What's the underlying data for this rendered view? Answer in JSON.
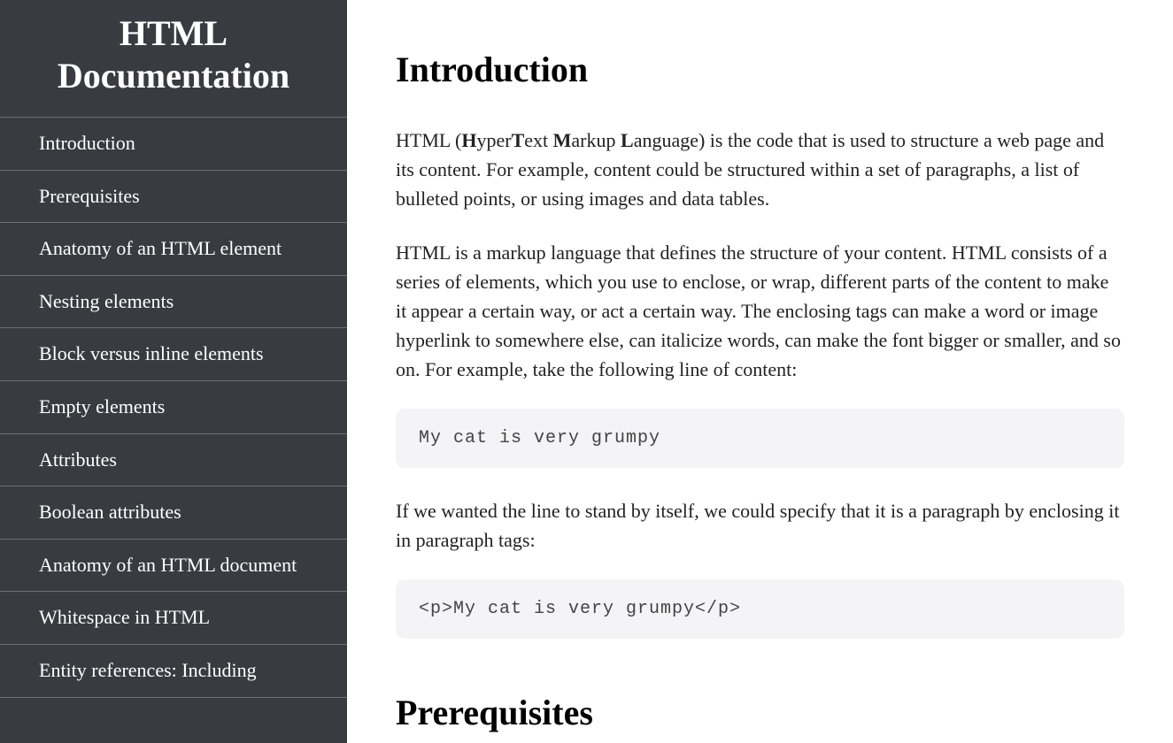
{
  "sidebar": {
    "title": "HTML Documentation",
    "items": [
      {
        "label": "Introduction"
      },
      {
        "label": "Prerequisites"
      },
      {
        "label": "Anatomy of an HTML element"
      },
      {
        "label": "Nesting elements"
      },
      {
        "label": "Block versus inline elements"
      },
      {
        "label": "Empty elements"
      },
      {
        "label": "Attributes"
      },
      {
        "label": "Boolean attributes"
      },
      {
        "label": "Anatomy of an HTML document"
      },
      {
        "label": "Whitespace in HTML"
      },
      {
        "label": "Entity references: Including"
      }
    ]
  },
  "main": {
    "sections": [
      {
        "heading": "Introduction",
        "p1_prefix": "HTML (",
        "p1_h": "H",
        "p1_yper": "yper",
        "p1_t": "T",
        "p1_ext": "ext ",
        "p1_m": "M",
        "p1_arkup": "arkup ",
        "p1_l": "L",
        "p1_anguage": "anguage) is the code that is used to structure a web page and its content. For example, content could be structured within a set of paragraphs, a list of bulleted points, or using images and data tables.",
        "p2": "HTML is a markup language that defines the structure of your content. HTML consists of a series of elements, which you use to enclose, or wrap, different parts of the content to make it appear a certain way, or act a certain way. The enclosing tags can make a word or image hyperlink to somewhere else, can italicize words, can make the font bigger or smaller, and so on. For example, take the following line of content:",
        "code1": "My cat is very grumpy",
        "p3": "If we wanted the line to stand by itself, we could specify that it is a paragraph by enclosing it in paragraph tags:",
        "code2": "<p>My cat is very grumpy</p>"
      },
      {
        "heading": "Prerequisites"
      }
    ]
  }
}
